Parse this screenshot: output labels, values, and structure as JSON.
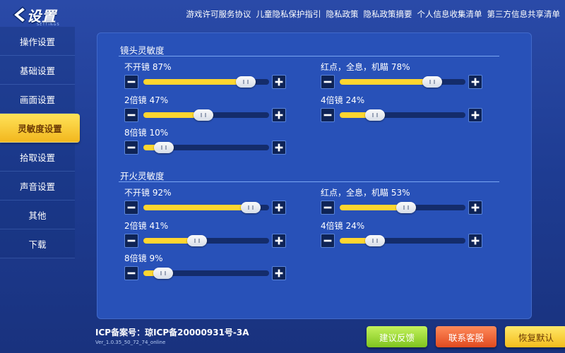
{
  "header": {
    "title": "设置",
    "subtitle": "SETTINGS",
    "links": [
      "游戏许可服务协议",
      "儿童隐私保护指引",
      "隐私政策",
      "隐私政策摘要",
      "个人信息收集清单",
      "第三方信息共享清单"
    ]
  },
  "sidebar": {
    "items": [
      {
        "label": "操作设置",
        "active": false
      },
      {
        "label": "基础设置",
        "active": false
      },
      {
        "label": "画面设置",
        "active": false
      },
      {
        "label": "灵敏度设置",
        "active": true
      },
      {
        "label": "拾取设置",
        "active": false
      },
      {
        "label": "声音设置",
        "active": false
      },
      {
        "label": "其他",
        "active": false
      },
      {
        "label": "下载",
        "active": false
      }
    ]
  },
  "sections": [
    {
      "title": "镜头灵敏度",
      "controls": [
        {
          "label": "不开镜 87%",
          "value": 87
        },
        {
          "label": "红点，全息，机瞄 78%",
          "value": 78
        },
        {
          "label": "2倍镜 47%",
          "value": 47
        },
        {
          "label": "4倍镜 24%",
          "value": 24
        },
        {
          "label": "8倍镜 10%",
          "value": 10
        }
      ]
    },
    {
      "title": "开火灵敏度",
      "controls": [
        {
          "label": "不开镜 92%",
          "value": 92
        },
        {
          "label": "红点，全息，机瞄 53%",
          "value": 53
        },
        {
          "label": "2倍镜 41%",
          "value": 41
        },
        {
          "label": "4倍镜 24%",
          "value": 24
        },
        {
          "label": "8倍镜 9%",
          "value": 9
        }
      ]
    }
  ],
  "footer": {
    "icp": "ICP备案号：琼ICP备20000931号-3A",
    "version": "Ver_1.0.35_50_72_74_online",
    "buttons": {
      "feedback": "建议反馈",
      "support": "联系客服",
      "reset": "恢复默认"
    }
  },
  "colors": {
    "accent": "#ffd630",
    "panel": "#2851b8",
    "background": "#1e3c92"
  }
}
